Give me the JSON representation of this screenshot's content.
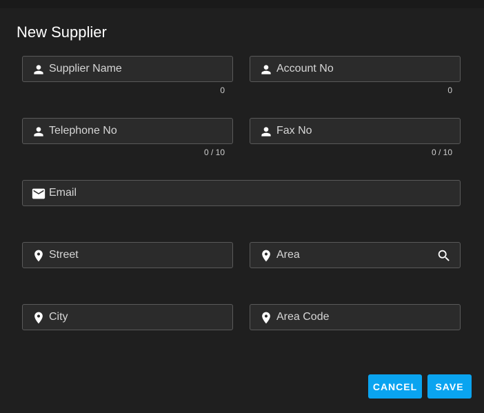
{
  "dialog": {
    "title": "New Supplier"
  },
  "fields": {
    "supplier_name": {
      "label": "Supplier Name",
      "icon": "person-icon",
      "counter": "0"
    },
    "account_no": {
      "label": "Account No",
      "icon": "person-icon",
      "counter": "0"
    },
    "telephone_no": {
      "label": "Telephone No",
      "icon": "person-icon",
      "counter": "0 / 10"
    },
    "fax_no": {
      "label": "Fax No",
      "icon": "person-icon",
      "counter": "0 / 10"
    },
    "email": {
      "label": "Email",
      "icon": "mail-icon"
    },
    "street": {
      "label": "Street",
      "icon": "location-pin-icon"
    },
    "area": {
      "label": "Area",
      "icon": "location-pin-icon",
      "trailing_icon": "search-icon"
    },
    "city": {
      "label": "City",
      "icon": "location-pin-icon"
    },
    "area_code": {
      "label": "Area Code",
      "icon": "location-pin-icon"
    }
  },
  "actions": {
    "cancel_label": "CANCEL",
    "save_label": "SAVE"
  },
  "colors": {
    "background": "#1f1f1f",
    "field_background": "#2b2b2b",
    "field_border": "#5a5a5a",
    "accent": "#0aa4f0",
    "text": "#d6d6d6"
  }
}
